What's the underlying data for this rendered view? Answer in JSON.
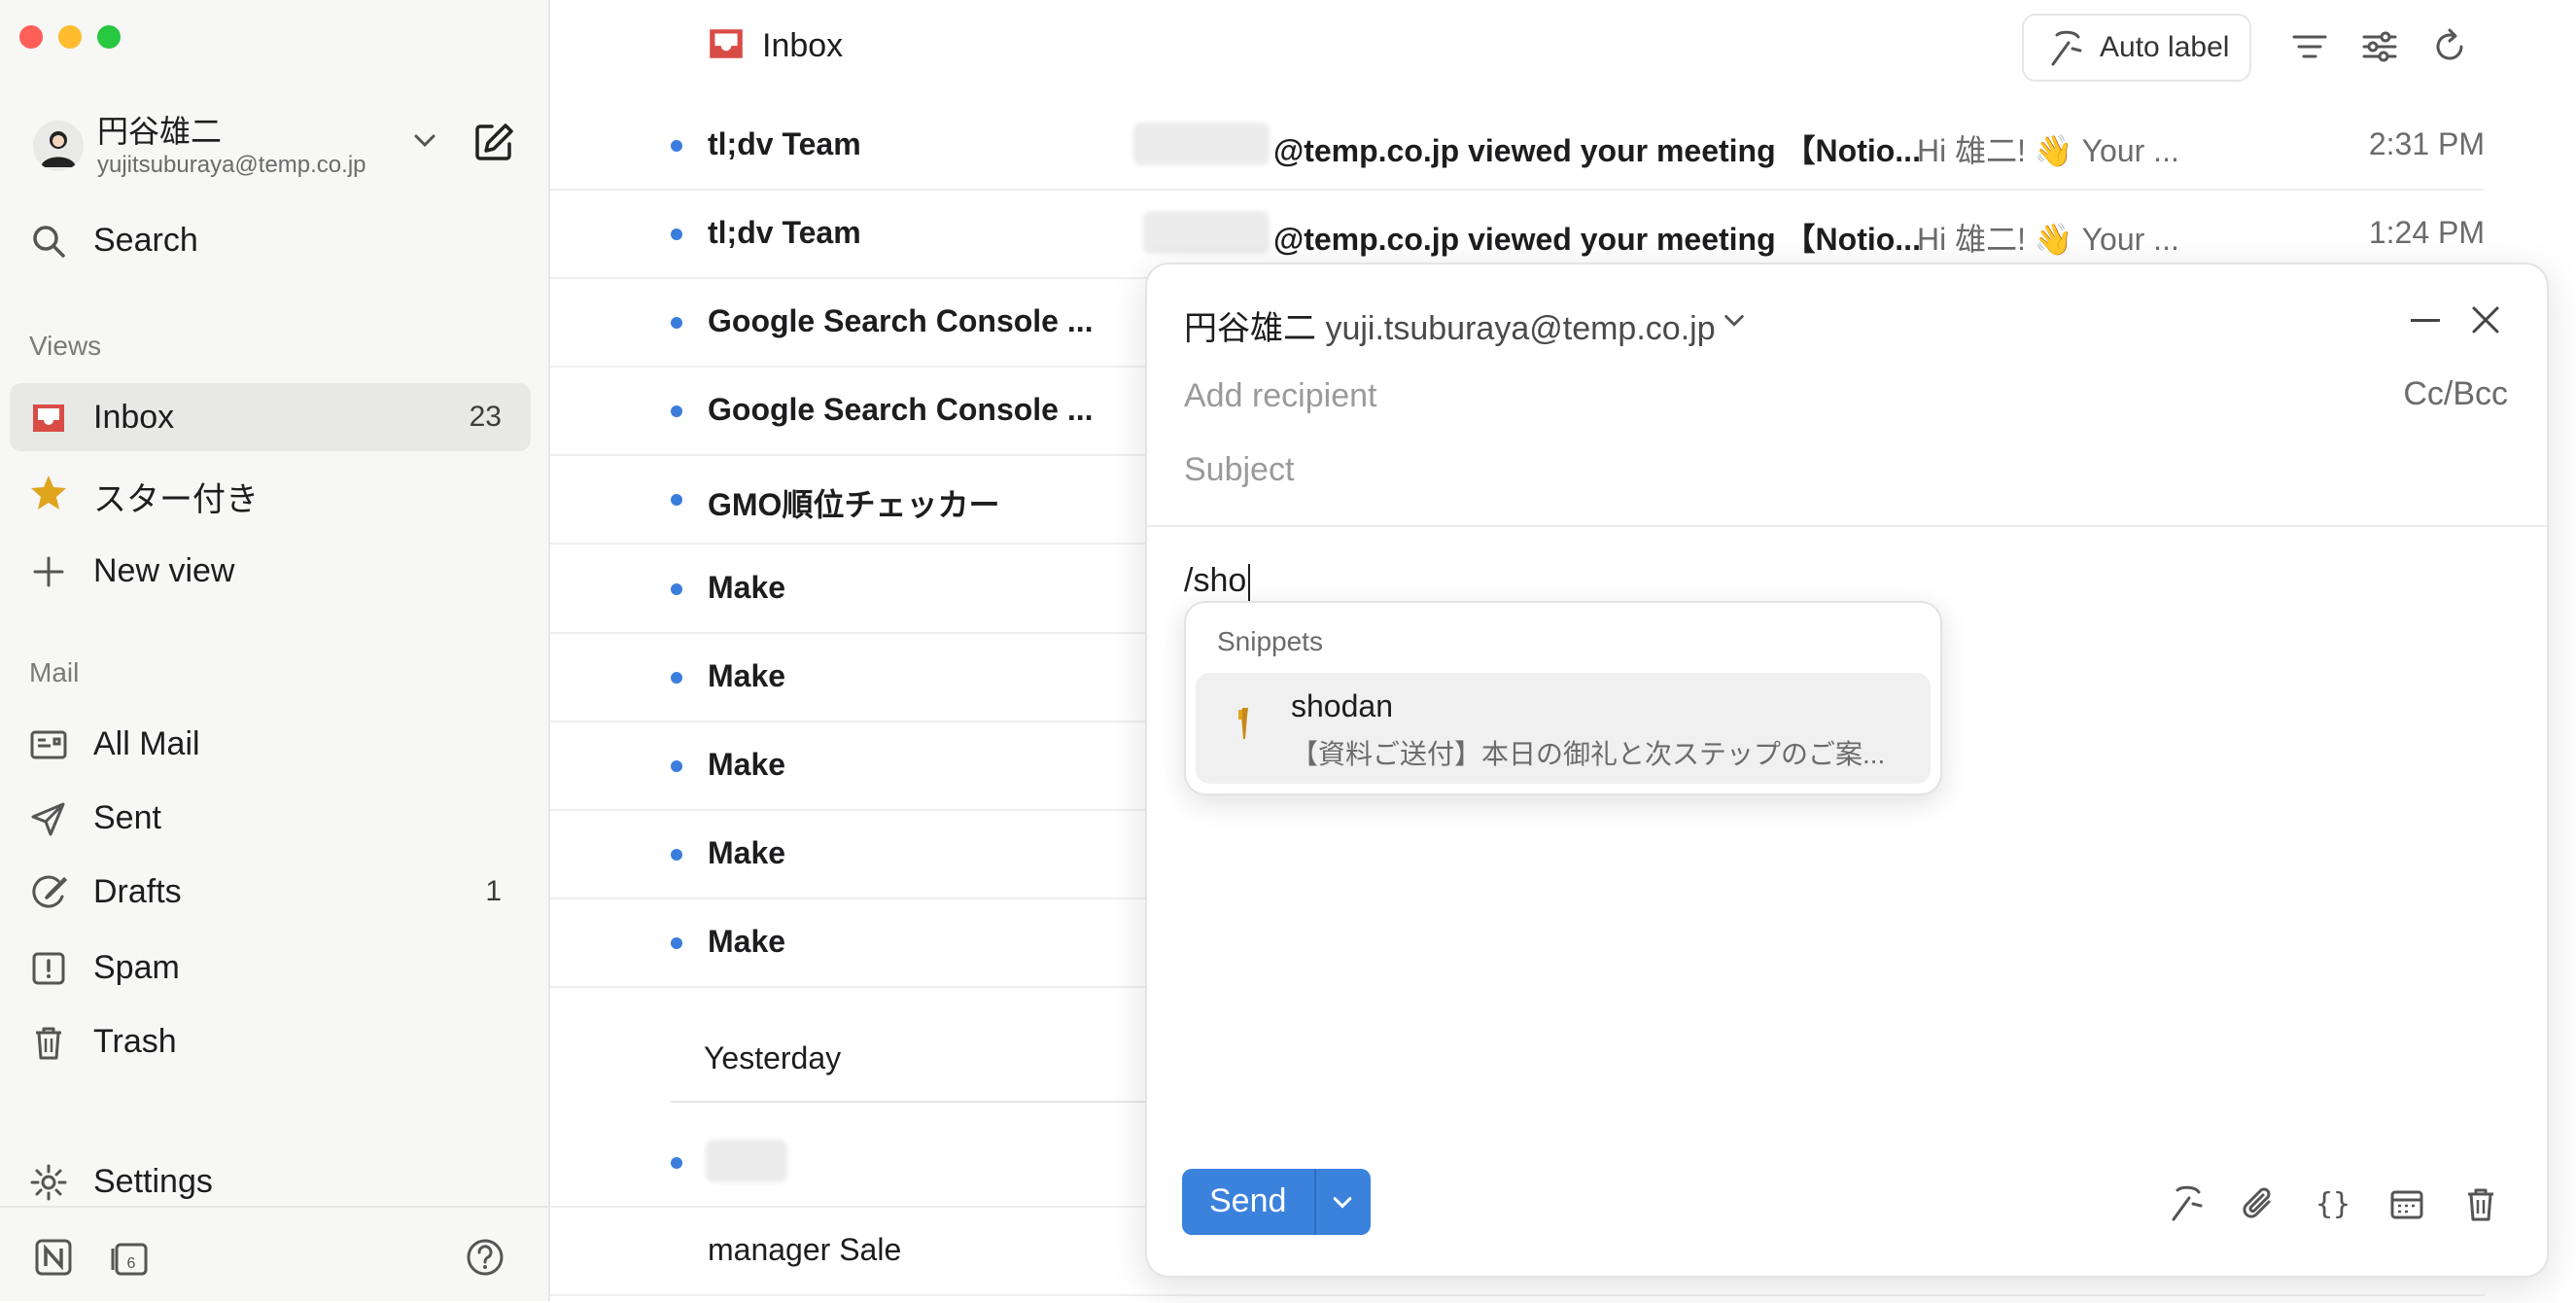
{
  "sidebar": {
    "account": {
      "name": "円谷雄二",
      "email": "yujitsuburaya@temp.co.jp"
    },
    "search_label": "Search",
    "views_label": "Views",
    "views": [
      {
        "label": "Inbox",
        "count": "23"
      },
      {
        "label": "スター付き",
        "count": ""
      },
      {
        "label": "New view",
        "count": ""
      }
    ],
    "mail_label": "Mail",
    "mail": [
      {
        "label": "All Mail",
        "count": ""
      },
      {
        "label": "Sent",
        "count": ""
      },
      {
        "label": "Drafts",
        "count": "1"
      },
      {
        "label": "Spam",
        "count": ""
      },
      {
        "label": "Trash",
        "count": ""
      }
    ],
    "settings_label": "Settings"
  },
  "header": {
    "title": "Inbox",
    "auto_label": "Auto label"
  },
  "emails": [
    {
      "sender": "tl;dv Team",
      "subject": "@temp.co.jp viewed your meeting 【Notio...",
      "preview": "Hi 雄二! 👋 Your ...",
      "time": "2:31 PM"
    },
    {
      "sender": "tl;dv Team",
      "subject": "@temp.co.jp viewed your meeting 【Notio...",
      "preview": "Hi 雄二! 👋 Your ...",
      "time": "1:24 PM"
    },
    {
      "sender": "Google Search Console ...",
      "subject": "",
      "preview": "",
      "time": ""
    },
    {
      "sender": "Google Search Console ...",
      "subject": "",
      "preview": "",
      "time": ""
    },
    {
      "sender": "GMO順位チェッカー",
      "subject": "",
      "preview": "",
      "time": ""
    },
    {
      "sender": "Make",
      "subject": "",
      "preview": "",
      "time": ""
    },
    {
      "sender": "Make",
      "subject": "",
      "preview": "",
      "time": ""
    },
    {
      "sender": "Make",
      "subject": "",
      "preview": "",
      "time": ""
    },
    {
      "sender": "Make",
      "subject": "",
      "preview": "",
      "time": ""
    },
    {
      "sender": "Make",
      "subject": "",
      "preview": "",
      "time": ""
    }
  ],
  "yesterday_label": "Yesterday",
  "yesterday_email": {
    "sender": "manager Sale"
  },
  "composer": {
    "from_name": "円谷雄二",
    "from_email": "yuji.tsuburaya@temp.co.jp",
    "recipient_placeholder": "Add recipient",
    "cc_bcc": "Cc/Bcc",
    "subject_placeholder": "Subject",
    "body": "/sho",
    "snippets_header": "Snippets",
    "snippet": {
      "title": "shodan",
      "desc": "【資料ご送付】本日の御礼と次ステップのご案..."
    },
    "send_label": "Send"
  },
  "colors": {
    "accent": "#3b82dd",
    "unread_dot": "#3b7ddd",
    "inbox_icon": "#d94b45",
    "star": "#e0a41d"
  }
}
